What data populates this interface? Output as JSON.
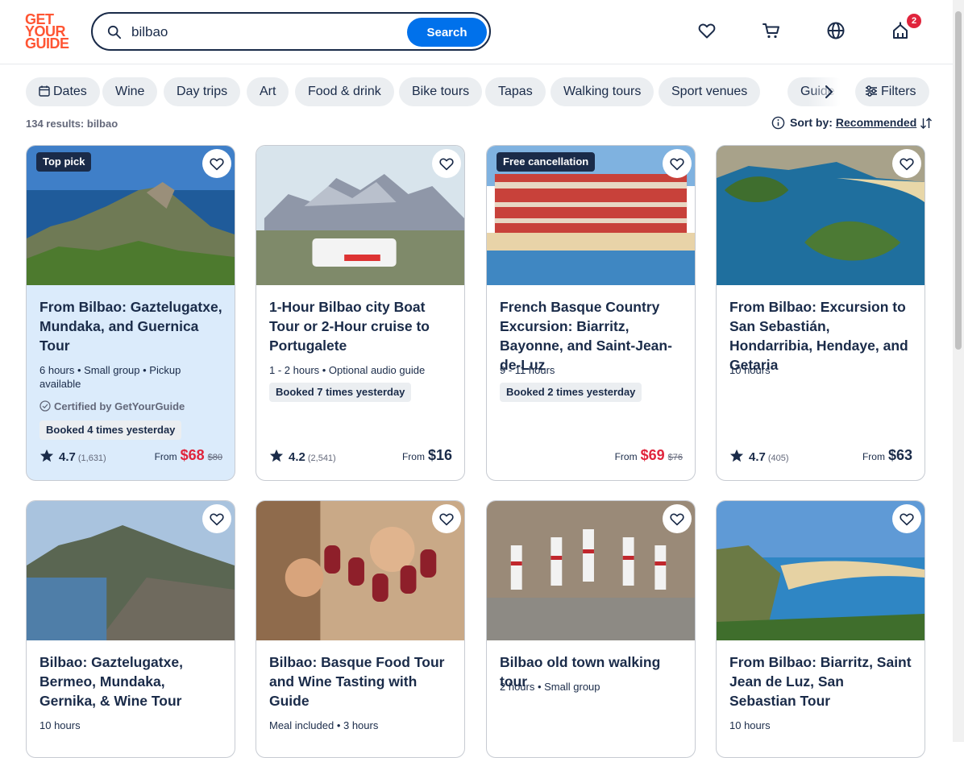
{
  "header": {
    "logo": [
      "GET",
      "YOUR",
      "GUIDE"
    ],
    "search_value": "bilbao",
    "search_button": "Search",
    "cart_badge": "2"
  },
  "chips": [
    "Dates",
    "Wine",
    "Day trips",
    "Art",
    "Food & drink",
    "Bike tours",
    "Tapas",
    "Walking tours",
    "Sport venues",
    "Guide"
  ],
  "filters_label": "Filters",
  "results_text": "134 results: bilbao",
  "sort": {
    "label": "Sort by:",
    "value": "Recommended"
  },
  "cards": [
    {
      "tag": "Top pick",
      "title": "From Bilbao: Gaztelugatxe, Mundaka, and Guernica Tour",
      "meta": "6 hours • Small group • Pickup available",
      "certified": "Certified by GetYourGuide",
      "booked": "Booked 4 times yesterday",
      "rating": "4.7",
      "reviews": "(1,631)",
      "from": "From",
      "price": "$68",
      "old_price": "$80"
    },
    {
      "tag": "",
      "title": "1-Hour Bilbao city Boat Tour or 2-Hour cruise to Portugalete",
      "meta": "1 - 2 hours • Optional audio guide",
      "booked": "Booked 7 times yesterday",
      "rating": "4.2",
      "reviews": "(2,541)",
      "from": "From",
      "price": "$16",
      "old_price": ""
    },
    {
      "tag": "Free cancellation",
      "title": "French Basque Country Excursion: Biarritz, Bayonne, and Saint-Jean-de-Luz",
      "meta": "9 - 11 hours",
      "booked": "Booked 2 times yesterday",
      "rating": "",
      "reviews": "",
      "from": "From",
      "price": "$69",
      "old_price": "$76"
    },
    {
      "tag": "",
      "title": "From Bilbao: Excursion to San Sebastián, Hondarribia, Hendaye, and Getaria",
      "meta": "10 hours",
      "booked": "",
      "rating": "4.7",
      "reviews": "(405)",
      "from": "From",
      "price": "$63",
      "old_price": ""
    },
    {
      "title": "Bilbao: Gaztelugatxe, Bermeo, Mundaka, Gernika, & Wine Tour",
      "meta": "10 hours"
    },
    {
      "title": "Bilbao: Basque Food Tour and Wine Tasting with Guide",
      "meta": "Meal included • 3 hours"
    },
    {
      "title": "Bilbao old town walking tour",
      "meta": "2 hours • Small group"
    },
    {
      "title": "From Bilbao: Biarritz, Saint Jean de Luz, San Sebastian Tour",
      "meta": "10 hours"
    }
  ],
  "colors": {
    "accent": "#0071eb",
    "brand": "#ff5533",
    "sale": "#e0243c",
    "text": "#1a2b49",
    "highlight": "#dbebfb"
  }
}
